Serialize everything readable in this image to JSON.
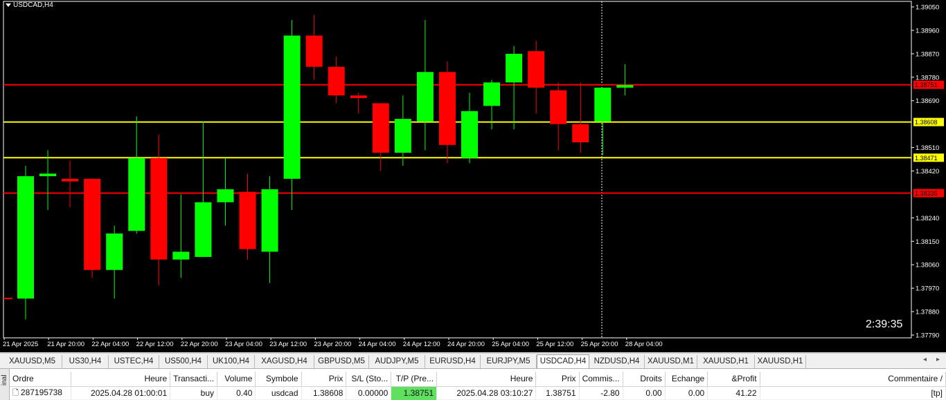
{
  "chart": {
    "title": "USDCAD,H4",
    "timer": "2:39:35",
    "price_min": 1.3779,
    "price_max": 1.3905,
    "price_labels": [
      "1.39050",
      "1.38960",
      "1.38870",
      "1.38780",
      "1.38690",
      "1.38510",
      "1.38420",
      "1.38240",
      "1.38150",
      "1.38060",
      "1.37970",
      "1.37880",
      "1.37790"
    ],
    "time_labels": [
      "21 Apr 2025",
      "21 Apr 20:00",
      "22 Apr 04:00",
      "22 Apr 12:00",
      "22 Apr 20:00",
      "23 Apr 04:00",
      "23 Apr 12:00",
      "23 Apr 20:00",
      "24 Apr 04:00",
      "24 Apr 12:00",
      "24 Apr 20:00",
      "25 Apr 04:00",
      "25 Apr 12:00",
      "25 Apr 20:00",
      "28 Apr 04:00"
    ],
    "hlines": [
      {
        "price": 1.38751,
        "label": "1.38751",
        "color": "#ff0000"
      },
      {
        "price": 1.38608,
        "label": "1.38608",
        "color": "#ffff00"
      },
      {
        "price": 1.38471,
        "label": "1.38471",
        "color": "#ffff00"
      },
      {
        "price": 1.38335,
        "label": "1.38335",
        "color": "#ff0000"
      }
    ],
    "bull_color": "#00ff00",
    "bear_color": "#ff0000"
  },
  "chart_data": {
    "type": "candlestick",
    "title": "USDCAD,H4",
    "candles": [
      {
        "o": 1.3793,
        "h": 1.3844,
        "l": 1.3785,
        "c": 1.384
      },
      {
        "o": 1.384,
        "h": 1.385,
        "l": 1.3827,
        "c": 1.3841
      },
      {
        "o": 1.3839,
        "h": 1.3846,
        "l": 1.3828,
        "c": 1.3838
      },
      {
        "o": 1.3839,
        "h": 1.3839,
        "l": 1.3801,
        "c": 1.3804
      },
      {
        "o": 1.3804,
        "h": 1.3821,
        "l": 1.3793,
        "c": 1.3818
      },
      {
        "o": 1.3819,
        "h": 1.3863,
        "l": 1.3818,
        "c": 1.3847
      },
      {
        "o": 1.3847,
        "h": 1.3856,
        "l": 1.3798,
        "c": 1.3808
      },
      {
        "o": 1.3808,
        "h": 1.3833,
        "l": 1.3801,
        "c": 1.3811
      },
      {
        "o": 1.3809,
        "h": 1.3861,
        "l": 1.3809,
        "c": 1.383
      },
      {
        "o": 1.383,
        "h": 1.3847,
        "l": 1.3821,
        "c": 1.3835
      },
      {
        "o": 1.3834,
        "h": 1.3841,
        "l": 1.3808,
        "c": 1.3812
      },
      {
        "o": 1.3811,
        "h": 1.384,
        "l": 1.3799,
        "c": 1.3835
      },
      {
        "o": 1.3839,
        "h": 1.39,
        "l": 1.3827,
        "c": 1.3894
      },
      {
        "o": 1.3894,
        "h": 1.3902,
        "l": 1.3877,
        "c": 1.3882
      },
      {
        "o": 1.3882,
        "h": 1.3886,
        "l": 1.3868,
        "c": 1.3871
      },
      {
        "o": 1.3871,
        "h": 1.3872,
        "l": 1.3864,
        "c": 1.387
      },
      {
        "o": 1.3868,
        "h": 1.3868,
        "l": 1.3842,
        "c": 1.3849
      },
      {
        "o": 1.3849,
        "h": 1.3871,
        "l": 1.3844,
        "c": 1.3862
      },
      {
        "o": 1.3861,
        "h": 1.39,
        "l": 1.385,
        "c": 1.388
      },
      {
        "o": 1.388,
        "h": 1.3884,
        "l": 1.3845,
        "c": 1.3852
      },
      {
        "o": 1.3847,
        "h": 1.3872,
        "l": 1.3845,
        "c": 1.3865
      },
      {
        "o": 1.3867,
        "h": 1.3877,
        "l": 1.3858,
        "c": 1.3876
      },
      {
        "o": 1.3876,
        "h": 1.389,
        "l": 1.3858,
        "c": 1.3887
      },
      {
        "o": 1.3888,
        "h": 1.3892,
        "l": 1.3864,
        "c": 1.3874
      },
      {
        "o": 1.3873,
        "h": 1.3876,
        "l": 1.385,
        "c": 1.386
      },
      {
        "o": 1.386,
        "h": 1.3876,
        "l": 1.3849,
        "c": 1.3853
      },
      {
        "o": 1.3861,
        "h": 1.3874,
        "l": 1.3848,
        "c": 1.3874
      },
      {
        "o": 1.3874,
        "h": 1.3883,
        "l": 1.3871,
        "c": 1.3875
      }
    ],
    "horizontal_levels": [
      1.38751,
      1.38608,
      1.38471,
      1.38335
    ]
  },
  "tabs": {
    "items": [
      "XAUUSD,M5",
      "US30,H4",
      "USTEC,H4",
      "US500,H4",
      "UK100,H4",
      "XAGUSD,H4",
      "GBPUSD,M5",
      "AUDJPY,M5",
      "EURUSD,H4",
      "EURJPY,M5",
      "USDCAD,H4",
      "NZDUSD,H4",
      "XAUUSD,M1",
      "XAUUSD,H1",
      "XAUUSD,H1"
    ],
    "active_index": 10
  },
  "terminal": {
    "side_label": "inal",
    "headers": [
      "Ordre",
      "Heure",
      "Transacti...",
      "Volume",
      "Symbole",
      "Prix",
      "S/L (Sto...",
      "T/P (Pre...",
      "Heure",
      "Prix",
      "Commis...",
      "Droits",
      "Echange",
      "&Profit",
      "Commentaire"
    ],
    "row": [
      "287195738",
      "2025.04.28 01:00:01",
      "buy",
      "0.40",
      "usdcad",
      "1.38608",
      "0.00000",
      "1.38751",
      "2025.04.28 03:10:27",
      "1.38751",
      "-2.80",
      "0.00",
      "0.00",
      "41.22",
      "[tp]"
    ]
  }
}
